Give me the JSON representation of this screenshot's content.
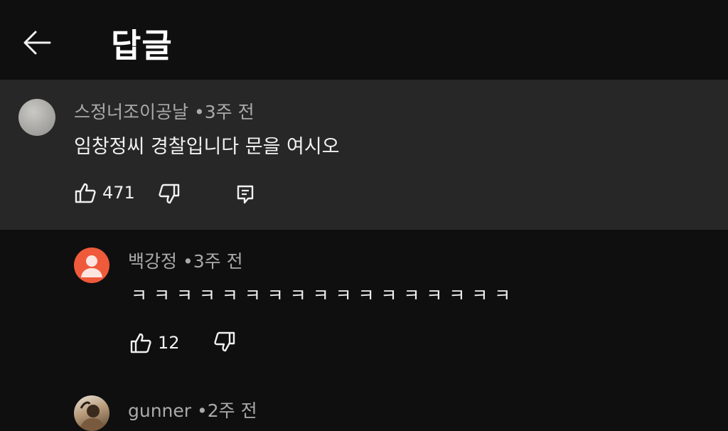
{
  "header": {
    "title": "답글"
  },
  "icons": {
    "back": "arrow-left-icon",
    "like": "thumbs-up-icon",
    "dislike": "thumbs-down-icon",
    "reply": "reply-comment-icon"
  },
  "colors": {
    "background": "#0f0f0f",
    "highlight": "#272727",
    "text": "#f1f1f1",
    "meta": "#aaaaaa",
    "default_avatar": "#ef5a3b"
  },
  "parent_comment": {
    "author": "스정너조이공날",
    "separator": "•",
    "time": "3주 전",
    "text": "임창정씨 경찰입니다 문을 여시오",
    "likes": "471"
  },
  "replies": [
    {
      "author": "백강정",
      "separator": "•",
      "time": "3주 전",
      "text": "ㅋ ㅋ ㅋ ㅋ ㅋ ㅋ ㅋ ㅋ ㅋ ㅋ ㅋ ㅋ ㅋ ㅋ ㅋ ㅋ ㅋ",
      "likes": "12"
    },
    {
      "author": "gunner",
      "separator": "•",
      "time": "2주 전"
    }
  ]
}
